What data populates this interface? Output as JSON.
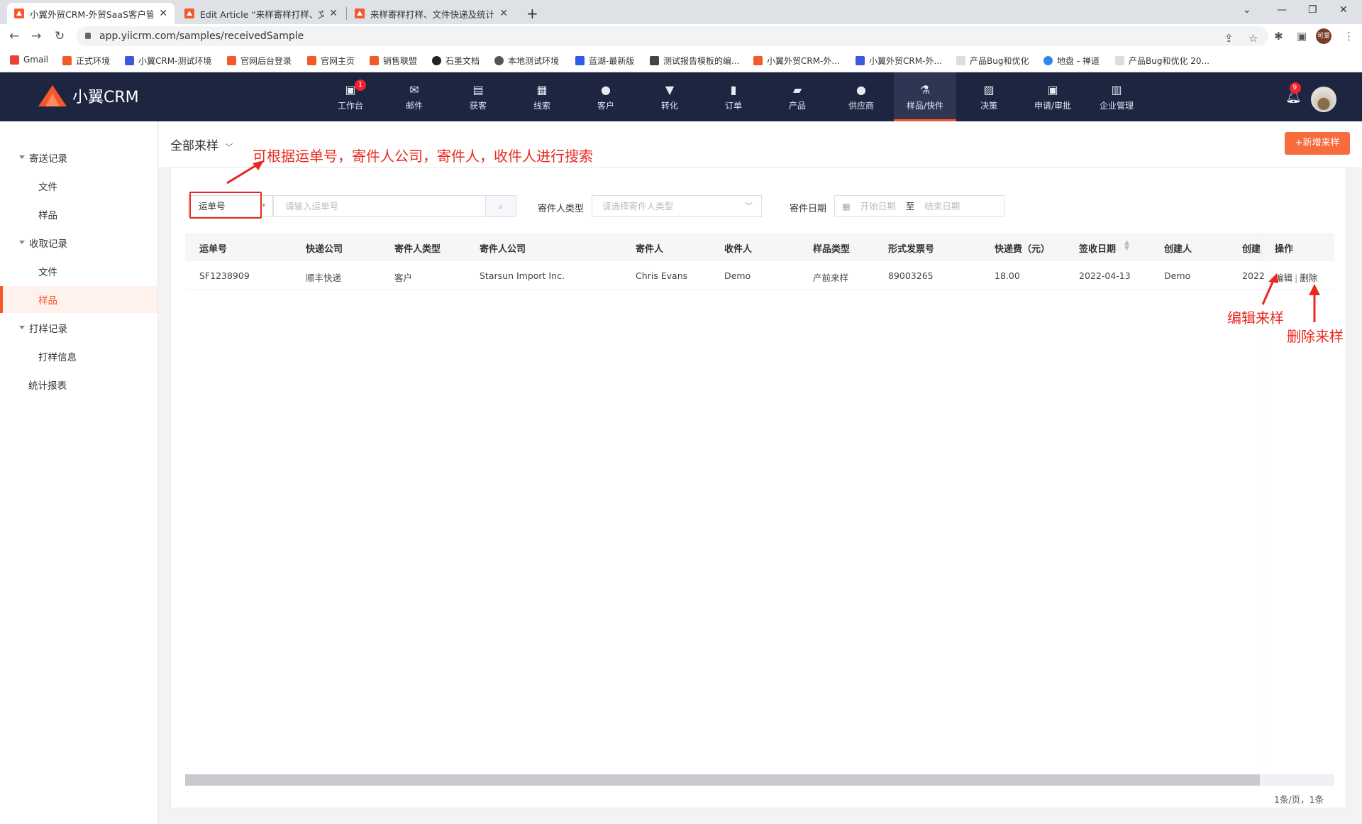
{
  "browser": {
    "tabs": [
      {
        "title": "小翼外贸CRM-外贸SaaS客户管理"
      },
      {
        "title": "Edit Article “来样寄样打样、文…"
      },
      {
        "title": "来样寄样打样、文件快递及统计…"
      }
    ],
    "new_tab": "+",
    "url": "app.yiicrm.com/samples/receivedSample",
    "profile_label": "可爱",
    "bookmarks": [
      "Gmail",
      "正式环境",
      "小翼CRM-测试环境",
      "官网后台登录",
      "官网主页",
      "销售联盟",
      "石墨文档",
      "本地测试环境",
      "蓝湖-最新版",
      "测试报告模板的编...",
      "小翼外贸CRM-外...",
      "小翼外贸CRM-外...",
      "产品Bug和优化",
      "地盘 - 禅道",
      "产品Bug和优化 20..."
    ]
  },
  "app": {
    "logo_text": "小翼CRM",
    "nav": [
      {
        "label": "工作台",
        "icon": "workbench-icon",
        "glyph": "▣",
        "badge": "1"
      },
      {
        "label": "邮件",
        "icon": "mail-icon",
        "glyph": "✉"
      },
      {
        "label": "获客",
        "icon": "acquire-icon",
        "glyph": "▤"
      },
      {
        "label": "线索",
        "icon": "lead-icon",
        "glyph": "▦"
      },
      {
        "label": "客户",
        "icon": "customer-icon",
        "glyph": "●"
      },
      {
        "label": "转化",
        "icon": "funnel-icon",
        "glyph": "▼"
      },
      {
        "label": "订单",
        "icon": "order-icon",
        "glyph": "▮"
      },
      {
        "label": "产品",
        "icon": "product-icon",
        "glyph": "▰"
      },
      {
        "label": "供应商",
        "icon": "supplier-icon",
        "glyph": "●"
      },
      {
        "label": "样品/快件",
        "icon": "flask-icon",
        "glyph": "⚗",
        "active": true
      },
      {
        "label": "决策",
        "icon": "chart-icon",
        "glyph": "▨"
      },
      {
        "label": "申请/审批",
        "icon": "approval-icon",
        "glyph": "▣"
      },
      {
        "label": "企业管理",
        "icon": "enterprise-icon",
        "glyph": "▥"
      }
    ],
    "notifications_badge": "9"
  },
  "sidebar": {
    "groups": [
      {
        "label": "寄送记录",
        "items": [
          "文件",
          "样品"
        ]
      },
      {
        "label": "收取记录",
        "items": [
          "文件",
          "样品"
        ],
        "active_item": "样品"
      },
      {
        "label": "打样记录",
        "items": [
          "打样信息"
        ]
      }
    ],
    "report": "统计报表"
  },
  "main": {
    "view_title": "全部来样",
    "add_button": "+新增来样",
    "filters": {
      "search_field": "运单号",
      "search_placeholder": "请输入运单号",
      "sender_type_label": "寄件人类型",
      "sender_type_placeholder": "请选择寄件人类型",
      "date_label": "寄件日期",
      "date_start": "开始日期",
      "date_sep": "至",
      "date_end": "结束日期"
    },
    "table": {
      "headers": [
        "运单号",
        "快递公司",
        "寄件人类型",
        "寄件人公司",
        "寄件人",
        "收件人",
        "样品类型",
        "形式发票号",
        "快递费（元）",
        "签收日期",
        "创建人",
        "创建",
        "操作"
      ],
      "rows": [
        [
          "SF1238909",
          "顺丰快递",
          "客户",
          "Starsun Import Inc.",
          "Chris Evans",
          "Demo",
          "产前来样",
          "89003265",
          "18.00",
          "2022-04-13",
          "Demo",
          "2022"
        ]
      ],
      "actions": {
        "edit": "编辑",
        "sep": "|",
        "delete": "删除"
      }
    },
    "pagination": "1条/页，1条"
  },
  "annotations": {
    "search_hint": "可根据运单号，寄件人公司，寄件人，收件人进行搜索",
    "edit_hint": "编辑来样",
    "delete_hint": "删除来样"
  },
  "colors": {
    "accent": "#f4592b",
    "header_bg": "#1d2541",
    "annotation": "#e8281e"
  }
}
